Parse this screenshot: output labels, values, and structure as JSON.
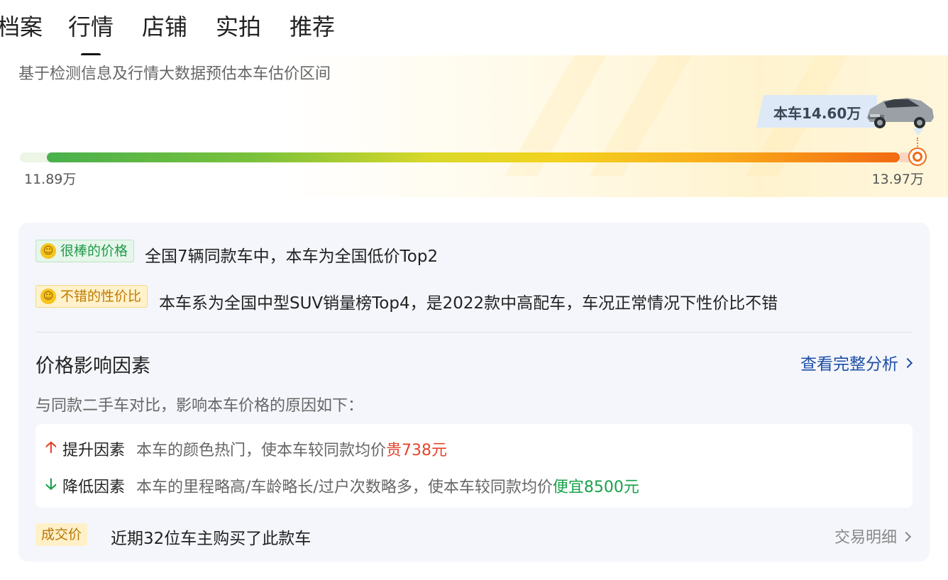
{
  "tabs": [
    {
      "label": "档案"
    },
    {
      "label": "行情",
      "active": true
    },
    {
      "label": "店铺"
    },
    {
      "label": "实拍"
    },
    {
      "label": "推荐"
    }
  ],
  "estimate": {
    "subtitle": "基于检测信息及行情大数据预估本车估价区间",
    "car_price_tag": "本车14.60万",
    "range_low": "11.89万",
    "range_high": "13.97万"
  },
  "analysis": {
    "badge_great": "很棒的价格",
    "line_great": "全国7辆同款车中，本车为全国低价Top2",
    "badge_good": "不错的性价比",
    "line_good": "本车系为全国中型SUV销量榜Top4，是2022款中高配车，车况正常情况下性价比不错",
    "section_title": "价格影响因素",
    "more_link": "查看完整分析",
    "compare_desc": "与同款二手车对比，影响本车价格的原因如下：",
    "factor_up": {
      "label": "提升因素",
      "desc": "本车的颜色热门，使本车较同款均价",
      "effect": "贵738元"
    },
    "factor_down": {
      "label": "降低因素",
      "desc": "本车的里程略高/车龄略长/过户次数略多，使本车较同款均价",
      "effect": "便宜8500元"
    },
    "deal_badge": "成交价",
    "deal_text": "近期32位车主购买了此款车",
    "deal_link": "交易明细"
  },
  "colors": {
    "accent_orange": "#f26a12",
    "link_blue": "#1f4fa6",
    "up_red": "#e4452d",
    "down_green": "#19a14a"
  },
  "icons": [
    "arrow-up-icon",
    "arrow-down-icon",
    "chevron-right-icon",
    "grin-emoji-icon",
    "smile-emoji-icon",
    "car-image"
  ]
}
